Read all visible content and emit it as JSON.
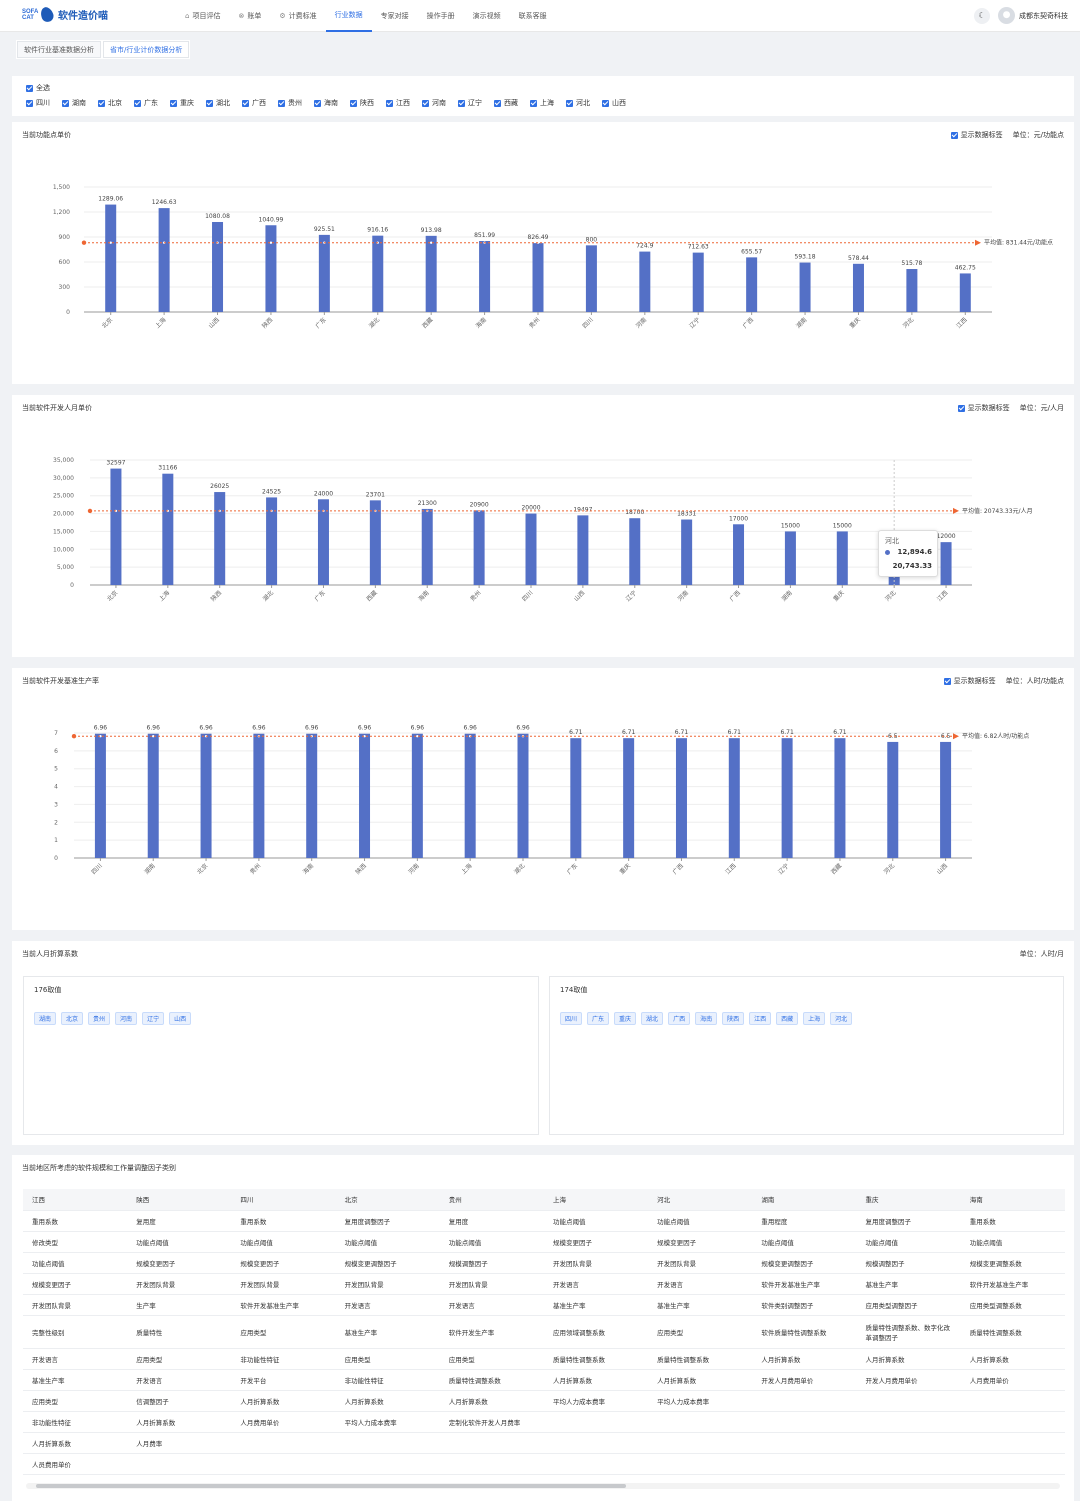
{
  "app": {
    "logo_mark": "SOFA CAT",
    "name": "软件造价喵",
    "user": "成都东契奇科技"
  },
  "nav": [
    {
      "icon": "home-icon",
      "glyph": "⌂",
      "label": "项目评估"
    },
    {
      "icon": "ledger-icon",
      "glyph": "⊗",
      "label": "账单"
    },
    {
      "icon": "settings-icon",
      "glyph": "⚙",
      "label": "计费标准"
    },
    {
      "label": "行业数据",
      "active": true
    },
    {
      "label": "专家对接"
    },
    {
      "label": "操作手册"
    },
    {
      "label": "演示视频"
    },
    {
      "label": "联系客服"
    }
  ],
  "tabs": [
    {
      "label": "软件行业基准数据分析"
    },
    {
      "label": "省市/行业计价数据分析",
      "active": true
    }
  ],
  "filter": {
    "select_all": "全选",
    "regions": [
      "四川",
      "湖南",
      "北京",
      "广东",
      "重庆",
      "湖北",
      "广西",
      "贵州",
      "海南",
      "陕西",
      "江西",
      "河南",
      "辽宁",
      "西藏",
      "上海",
      "河北",
      "山西"
    ]
  },
  "show_labels": "显示数据标签",
  "chart_data": [
    {
      "type": "bar",
      "title": "当前功能点单价",
      "unit": "单位：元/功能点",
      "categories": [
        "北京",
        "上海",
        "山西",
        "陕西",
        "广东",
        "湖北",
        "西藏",
        "海南",
        "贵州",
        "四川",
        "河南",
        "辽宁",
        "广西",
        "湖南",
        "重庆",
        "河北",
        "江西"
      ],
      "values": [
        1289.06,
        1246.63,
        1080.08,
        1040.99,
        925.51,
        916.16,
        913.98,
        851.99,
        826.49,
        800,
        724.9,
        712.63,
        655.57,
        593.18,
        578.44,
        515.78,
        462.75
      ],
      "ylim": [
        0,
        1500
      ],
      "yticks": [
        0,
        300,
        600,
        900,
        1200,
        1500
      ],
      "yticklabels": [
        "0",
        "300",
        "600",
        "900",
        "1,200",
        "1,500"
      ],
      "avg": 831.44,
      "avg_label": "平均值: 831.44元/功能点",
      "labels": [
        "1289.06",
        "1246.63",
        "1080.08",
        "1040.99",
        "925.51",
        "916.16",
        "913.98",
        "851.99",
        "826.49",
        "800",
        "724.9",
        "712.63",
        "655.57",
        "593.18",
        "578.44",
        "515.78",
        "462.75"
      ],
      "color": "#5470c6"
    },
    {
      "type": "bar",
      "title": "当前软件开发人月单价",
      "unit": "单位：元/人月",
      "categories": [
        "北京",
        "上海",
        "陕西",
        "湖北",
        "广东",
        "西藏",
        "海南",
        "贵州",
        "四川",
        "山西",
        "辽宁",
        "河南",
        "广西",
        "湖南",
        "重庆",
        "河北",
        "江西"
      ],
      "values": [
        32597,
        31166,
        26025,
        24525,
        24000,
        23701,
        21300,
        20900,
        20000,
        19497,
        18700,
        18331,
        17000,
        15000,
        15000,
        12894.6,
        12000
      ],
      "ylim": [
        0,
        35000
      ],
      "yticks": [
        0,
        5000,
        10000,
        15000,
        20000,
        25000,
        30000,
        35000
      ],
      "yticklabels": [
        "0",
        "5,000",
        "10,000",
        "15,000",
        "20,000",
        "25,000",
        "30,000",
        "35,000"
      ],
      "avg": 20743.33,
      "avg_label": "平均值: 20743.33元/人月",
      "labels": [
        "32597",
        "31166",
        "26025",
        "24525",
        "24000",
        "23701",
        "21300",
        "20900",
        "20000",
        "19497",
        "18700",
        "18331",
        "17000",
        "15000",
        "15000",
        "12894.6",
        "12000"
      ],
      "color": "#5470c6",
      "tooltip": {
        "name": "河北",
        "value": "12,894.6",
        "avg": "20,743.33"
      }
    },
    {
      "type": "bar",
      "title": "当前软件开发基准生产率",
      "unit": "单位：人时/功能点",
      "categories": [
        "四川",
        "湖南",
        "北京",
        "贵州",
        "海南",
        "陕西",
        "河南",
        "上海",
        "湖北",
        "广东",
        "重庆",
        "广西",
        "江西",
        "辽宁",
        "西藏",
        "河北",
        "山西"
      ],
      "values": [
        6.96,
        6.96,
        6.96,
        6.96,
        6.96,
        6.96,
        6.96,
        6.96,
        6.96,
        6.71,
        6.71,
        6.71,
        6.71,
        6.71,
        6.71,
        6.5,
        6.5
      ],
      "ylim": [
        0,
        7
      ],
      "yticks": [
        0,
        1,
        2,
        3,
        4,
        5,
        6,
        7
      ],
      "yticklabels": [
        "0",
        "1",
        "2",
        "3",
        "4",
        "5",
        "6",
        "7"
      ],
      "avg": 6.82,
      "avg_label": "平均值: 6.82人时/功能点",
      "labels": [
        "6.96",
        "6.96",
        "6.96",
        "6.96",
        "6.96",
        "6.96",
        "6.96",
        "6.96",
        "6.96",
        "6.71",
        "6.71",
        "6.71",
        "6.71",
        "6.71",
        "6.71",
        "6.5",
        "6.5"
      ],
      "color": "#5470c6"
    }
  ],
  "coef": {
    "title": "当前人月折算系数",
    "unit": "单位：人时/月",
    "groups": [
      {
        "title": "176取值",
        "regions": [
          "湖南",
          "北京",
          "贵州",
          "河南",
          "辽宁",
          "山西"
        ]
      },
      {
        "title": "174取值",
        "regions": [
          "四川",
          "广东",
          "重庆",
          "湖北",
          "广西",
          "海南",
          "陕西",
          "江西",
          "西藏",
          "上海",
          "河北"
        ]
      }
    ]
  },
  "factors": {
    "title": "当前地区所考虑的软件规模和工作量调整因子类别",
    "headers": [
      "江西",
      "陕西",
      "四川",
      "北京",
      "贵州",
      "上海",
      "河北",
      "湖南",
      "重庆",
      "海南"
    ],
    "rows": [
      [
        "重用系数",
        "复用度",
        "重用系数",
        "复用度调整因子",
        "复用度",
        "功能点阈值",
        "功能点阈值",
        "重用程度",
        "复用度调整因子",
        "重用系数"
      ],
      [
        "修改类型",
        "功能点阈值",
        "功能点阈值",
        "功能点阈值",
        "功能点阈值",
        "规模变更因子",
        "规模变更因子",
        "功能点阈值",
        "功能点阈值",
        "功能点阈值"
      ],
      [
        "功能点阈值",
        "规模变更因子",
        "规模变更因子",
        "规模变更调整因子",
        "规模调整因子",
        "开发团队背景",
        "开发团队背景",
        "规模变更调整因子",
        "规模调整因子",
        "规模变更调整系数"
      ],
      [
        "规模变更因子",
        "开发团队背景",
        "开发团队背景",
        "开发团队背景",
        "开发团队背景",
        "开发语言",
        "开发语言",
        "软件开发基准生产率",
        "基准生产率",
        "软件开发基准生产率"
      ],
      [
        "开发团队背景",
        "生产率",
        "软件开发基准生产率",
        "开发语言",
        "开发语言",
        "基准生产率",
        "基准生产率",
        "软件类别调整因子",
        "应用类型调整因子",
        "应用类型调整系数"
      ],
      [
        "完整性级别",
        "质量特性",
        "应用类型",
        "基准生产率",
        "软件开发生产率",
        "应用领域调整系数",
        "应用类型",
        "软件质量特性调整系数",
        "质量特性调整系数、数字化改革调整因子",
        "质量特性调整系数"
      ],
      [
        "开发语言",
        "应用类型",
        "非功能性特征",
        "应用类型",
        "应用类型",
        "质量特性调整系数",
        "质量特性调整系数",
        "人月折算系数",
        "人月折算系数",
        "人月折算系数"
      ],
      [
        "基准生产率",
        "开发语言",
        "开发平台",
        "非功能性特征",
        "质量特性调整系数",
        "人月折算系数",
        "人月折算系数",
        "开发人月费用单价",
        "开发人月费用单价",
        "人月费用单价"
      ],
      [
        "应用类型",
        "信调整因子",
        "人月折算系数",
        "人月折算系数",
        "人月折算系数",
        "平均人力成本费率",
        "平均人力成本费率",
        "",
        "",
        ""
      ],
      [
        "非功能性特征",
        "人月折算系数",
        "人月费用单价",
        "平均人力成本费率",
        "定制化软件开发人月费率",
        "",
        "",
        "",
        "",
        ""
      ],
      [
        "人月折算系数",
        "人月费率",
        "",
        "",
        "",
        "",
        "",
        "",
        "",
        ""
      ],
      [
        "人员费用单价",
        "",
        "",
        "",
        "",
        "",
        "",
        "",
        "",
        ""
      ]
    ]
  }
}
